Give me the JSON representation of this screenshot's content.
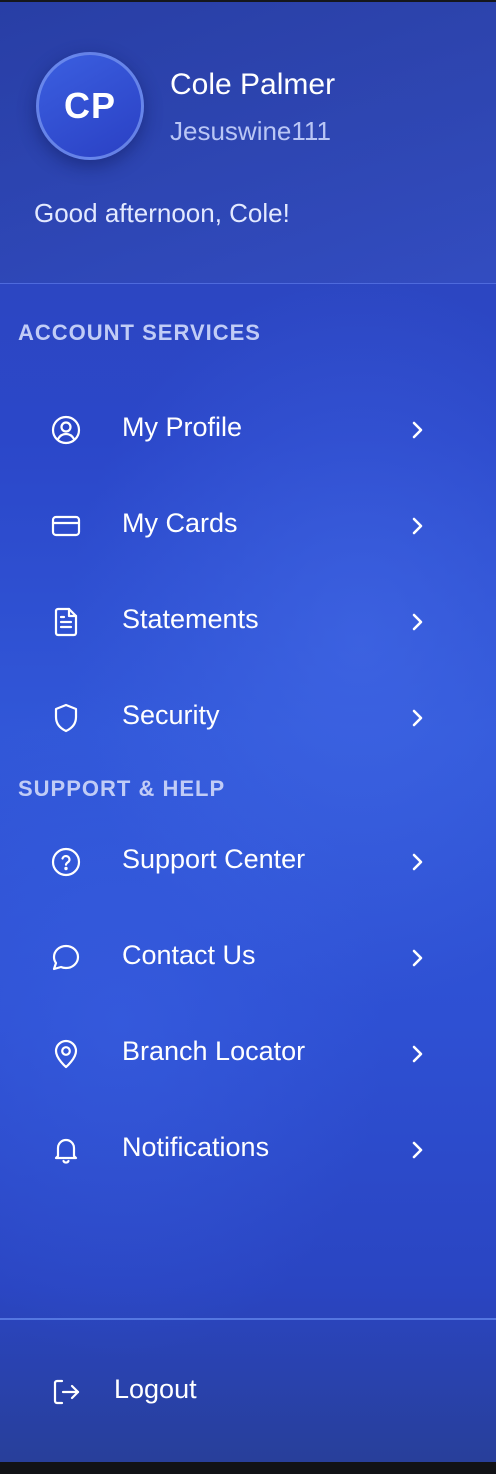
{
  "profile": {
    "initials": "CP",
    "name": "Cole Palmer",
    "handle": "Jesuswine111",
    "greeting": "Good afternoon, Cole!"
  },
  "sections": {
    "account": {
      "title": "ACCOUNT SERVICES",
      "items": [
        {
          "label": "My Profile",
          "icon": "user-circle-icon"
        },
        {
          "label": "My Cards",
          "icon": "credit-card-icon"
        },
        {
          "label": "Statements",
          "icon": "document-icon"
        },
        {
          "label": "Security",
          "icon": "shield-icon"
        }
      ]
    },
    "support": {
      "title": "SUPPORT & HELP",
      "items": [
        {
          "label": "Support Center",
          "icon": "help-circle-icon"
        },
        {
          "label": "Contact Us",
          "icon": "chat-bubble-icon"
        },
        {
          "label": "Branch Locator",
          "icon": "map-pin-icon"
        },
        {
          "label": "Notifications",
          "icon": "bell-icon"
        }
      ]
    }
  },
  "footer": {
    "logout_label": "Logout",
    "logout_icon": "logout-icon"
  },
  "colors": {
    "accent": "#3157d8",
    "text_primary": "#ffffff",
    "text_muted": "#b9c6f5"
  }
}
